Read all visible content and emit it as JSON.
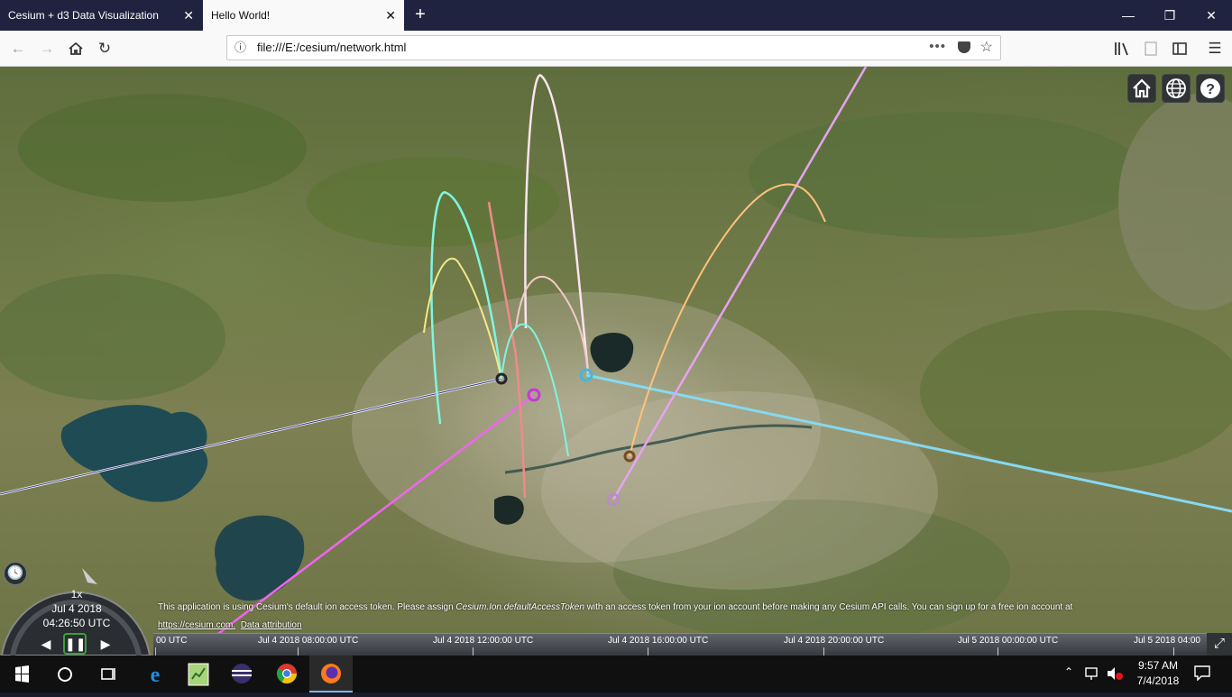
{
  "browser": {
    "tabs": [
      {
        "title": "Cesium + d3 Data Visualization",
        "active": false
      },
      {
        "title": "Hello World!",
        "active": true
      }
    ],
    "close_glyph": "✕",
    "new_tab_glyph": "+",
    "url": "file:///E:/cesium/network.html",
    "page_actions_glyph": "•••"
  },
  "viewer": {
    "toolbar_icons": [
      "home-icon",
      "globe-icon",
      "help-icon"
    ],
    "animation": {
      "speed": "1x",
      "date": "Jul 4 2018",
      "time": "04:26:50 UTC"
    },
    "credits": {
      "notice_prefix": "This application is using Cesium's default ion access token. Please assign ",
      "notice_code": "Cesium.Ion.defaultAccessToken",
      "notice_suffix": " with an access token from your ion account before making any Cesium API calls. You can sign up for a free ion account at",
      "cesium_link": "https://cesium.com.",
      "attribution_link": "Data attribution"
    },
    "timeline_ticks": [
      "00 UTC",
      "Jul 4 2018 08:00:00 UTC",
      "Jul 4 2018 12:00:00 UTC",
      "Jul 4 2018 16:00:00 UTC",
      "Jul 4 2018 20:00:00 UTC",
      "Jul 5 2018 00:00:00 UTC",
      "Jul 5 2018 04:00"
    ],
    "arc_colors": [
      "#7ff5df",
      "#f2e98a",
      "#f08a8a",
      "#fbe4f0",
      "#f5c9c9",
      "#ffc27a",
      "#e6a3f0",
      "#ee66ee",
      "#85d9f2",
      "#ffffff"
    ]
  },
  "taskbar": {
    "apps": [
      "windows-start-icon",
      "cortana-icon",
      "task-view-icon",
      "edge-icon",
      "notepad-icon",
      "eclipse-icon",
      "chrome-icon",
      "firefox-icon"
    ],
    "time": "9:57 AM",
    "date": "7/4/2018"
  }
}
